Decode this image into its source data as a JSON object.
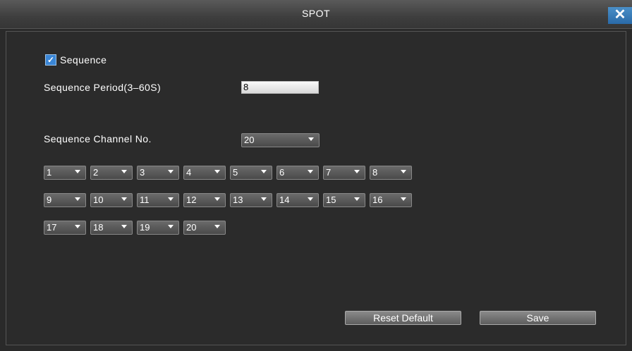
{
  "window": {
    "title": "SPOT",
    "close_glyph": "✕"
  },
  "sequence": {
    "label": "Sequence",
    "checked": true,
    "check_glyph": "✓"
  },
  "period": {
    "label": "Sequence Period(3–60S)",
    "value": "8"
  },
  "channel_no": {
    "label": "Sequence Channel No.",
    "value": "20"
  },
  "channels": [
    "1",
    "2",
    "3",
    "4",
    "5",
    "6",
    "7",
    "8",
    "9",
    "10",
    "11",
    "12",
    "13",
    "14",
    "15",
    "16",
    "17",
    "18",
    "19",
    "20"
  ],
  "buttons": {
    "reset": "Reset Default",
    "save": "Save"
  }
}
